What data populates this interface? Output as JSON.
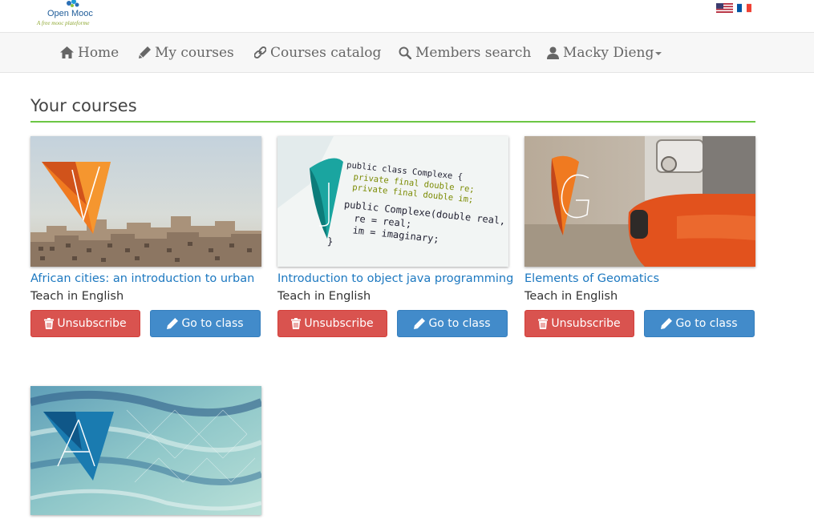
{
  "header": {
    "logo_name": "Open Mooc",
    "logo_tagline": "A free mooc plateforme",
    "languages": [
      {
        "name": "english-flag-icon"
      },
      {
        "name": "french-flag-icon"
      }
    ]
  },
  "nav": {
    "items": [
      {
        "label": "Home",
        "icon": "home-icon"
      },
      {
        "label": "My courses",
        "icon": "pencil-icon"
      },
      {
        "label": "Courses catalog",
        "icon": "link-icon"
      },
      {
        "label": "Members search",
        "icon": "search-icon"
      },
      {
        "label": "Macky Dieng",
        "icon": "user-icon"
      }
    ]
  },
  "main": {
    "section_title": "Your courses",
    "courses": [
      {
        "title": "African cities: an introduction to urban",
        "language": "Teach in English",
        "letter": "V",
        "unsubscribe_label": "Unsubscribe",
        "go_label": "Go to class"
      },
      {
        "title": "Introduction to object java programming",
        "language": "Teach in English",
        "letter": "J",
        "unsubscribe_label": "Unsubscribe",
        "go_label": "Go to class"
      },
      {
        "title": "Elements of Geomatics",
        "language": "Teach in English",
        "letter": "G",
        "unsubscribe_label": "Unsubscribe",
        "go_label": "Go to class"
      },
      {
        "letter": "A"
      }
    ],
    "code_lines": [
      "public class Complexe {",
      "private final double re;",
      "private final double im;",
      "public Complexe(double real, doub",
      "re = real;",
      "im = imaginary;",
      "}"
    ]
  },
  "colors": {
    "accent_green": "#6cc644",
    "danger": "#d9534f",
    "primary": "#428bca",
    "link": "#1c78c0"
  }
}
